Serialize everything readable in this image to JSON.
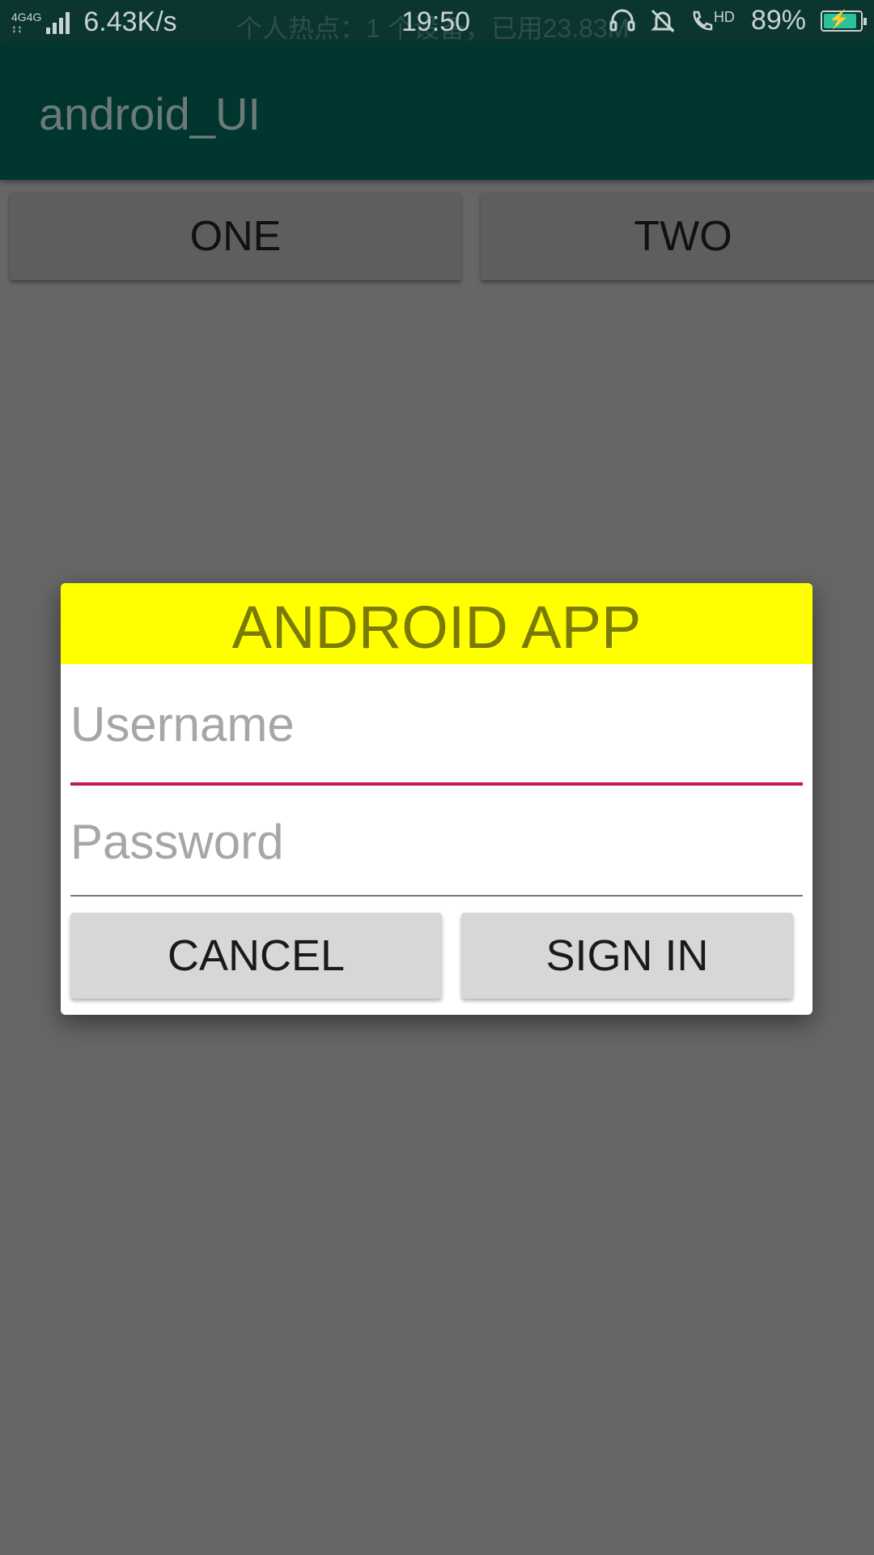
{
  "status_bar": {
    "network_1": "4G",
    "network_2": "4G",
    "speed": "6.43K/s",
    "notification": "个人热点：1 个设备，已用23.83M",
    "time": "19:50",
    "call_badge": "HD",
    "battery": "89%",
    "icons": [
      "headset-icon",
      "bell-muted-icon",
      "hd-call-icon",
      "battery-charging-icon"
    ]
  },
  "app_bar": {
    "title": "android_UI"
  },
  "top_buttons": {
    "one": "ONE",
    "two": "TWO"
  },
  "dialog": {
    "title": "ANDROID APP",
    "username_placeholder": "Username",
    "password_placeholder": "Password",
    "cancel": "CANCEL",
    "sign_in": "SIGN IN",
    "title_bg": "#ffff00",
    "accent": "#c2185b"
  }
}
